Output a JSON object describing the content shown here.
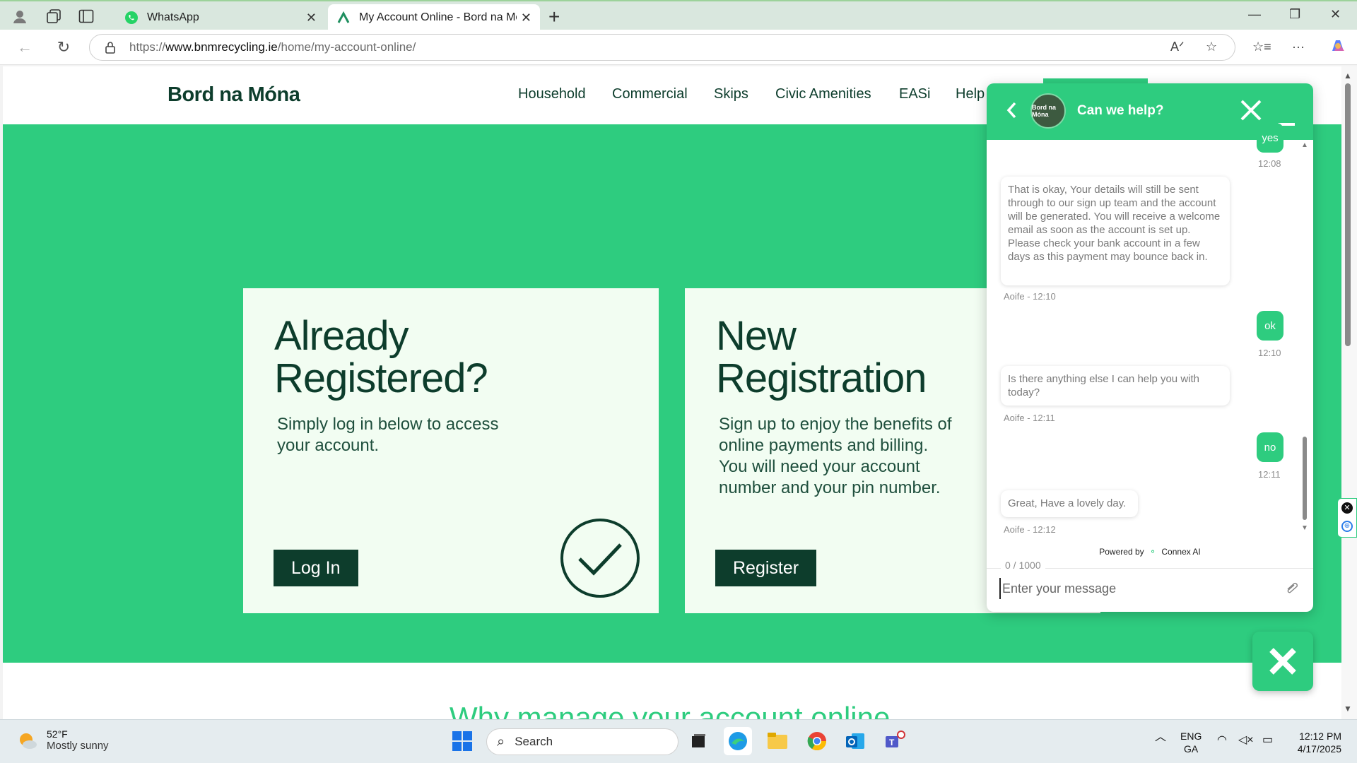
{
  "browser": {
    "tabs": [
      {
        "title": "WhatsApp",
        "active": false
      },
      {
        "title": "My Account Online - Bord na Móna",
        "active": true
      }
    ],
    "url_prefix": "https://",
    "url_domain": "www.bnmrecycling.ie",
    "url_path": "/home/my-account-online/"
  },
  "site": {
    "logo": "Bord na Móna",
    "nav": [
      "Household",
      "Commercial",
      "Skips",
      "Civic Amenities",
      "EASi",
      "Help"
    ],
    "card_login": {
      "heading_1": "Already",
      "heading_2": "Registered?",
      "text": "Simply log in below to access your account.",
      "button": "Log In"
    },
    "card_register": {
      "heading_1": "New",
      "heading_2": "Registration",
      "text": "Sign up to enjoy the benefits of online payments and billing. You will need your account number and your pin number.",
      "button": "Register"
    },
    "bottom_heading": "Why manage your account online"
  },
  "chat": {
    "title": "Can we help?",
    "avatar_text": "Bord na Móna",
    "messages": [
      {
        "from": "user",
        "text": "yes",
        "meta": "12:08"
      },
      {
        "from": "agent",
        "text": "That is okay, Your details will still be sent through to our sign up team and the account will be generated. You will receive a welcome email as soon as the account is set up. Please check your bank account in a few days as this payment may bounce back in.",
        "meta": "Aoife - 12:10"
      },
      {
        "from": "user",
        "text": "ok",
        "meta": "12:10"
      },
      {
        "from": "agent",
        "text": "Is there anything else I can help you with today?",
        "meta": "Aoife - 12:11"
      },
      {
        "from": "user",
        "text": "no",
        "meta": "12:11"
      },
      {
        "from": "agent",
        "text": "Great, Have a lovely day.",
        "meta": "Aoife - 12:12"
      }
    ],
    "powered_by": "Powered by",
    "powered_brand": "Connex AI",
    "counter": "0 / 1000",
    "input_placeholder": "Enter your message"
  },
  "taskbar": {
    "weather_temp": "52°F",
    "weather_desc": "Mostly sunny",
    "search": "Search",
    "lang_1": "ENG",
    "lang_2": "GA",
    "time": "12:12 PM",
    "date": "4/17/2025"
  },
  "colors": {
    "brand_green": "#2ecc7f",
    "brand_dark": "#0d3d2c",
    "card_bg": "#f2fdf2"
  }
}
